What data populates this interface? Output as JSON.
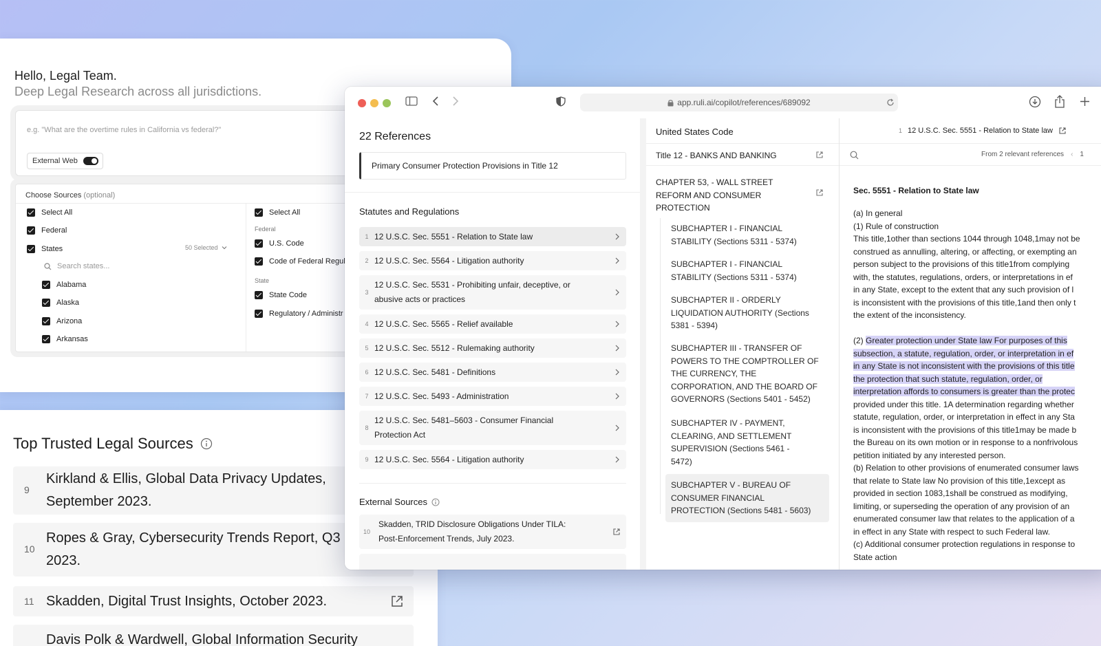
{
  "home": {
    "greeting": "Hello, Legal Team.",
    "subtitle": "Deep Legal Research across all jurisdictions.",
    "query_placeholder": "e.g. \"What are the overtime rules in California vs federal?\"",
    "external_web_label": "External Web",
    "external_web_on": true,
    "sources": {
      "title": "Choose Sources",
      "optional": "(optional)",
      "left": {
        "select_all": "Select All",
        "federal": "Federal",
        "states": "States",
        "states_count": "50 Selected",
        "search_placeholder": "Search states...",
        "state_items": [
          "Alabama",
          "Alaska",
          "Arizona",
          "Arkansas"
        ]
      },
      "right": {
        "select_all": "Select All",
        "federal_label": "Federal",
        "federal_items": [
          "U.S. Code",
          "Code of Federal Regul"
        ],
        "state_label": "State",
        "state_items": [
          "State Code",
          "Regulatory / Administr"
        ]
      }
    }
  },
  "trusted": {
    "title": "Top Trusted Legal Sources",
    "items": [
      {
        "num": "9",
        "lines": [
          "Kirkland & Ellis, Global Data Privacy Updates,",
          "September 2023."
        ]
      },
      {
        "num": "10",
        "lines": [
          "Ropes & Gray, Cybersecurity Trends Report, Q3",
          "2023."
        ]
      },
      {
        "num": "11",
        "lines": [
          "Skadden, Digital Trust Insights, October 2023."
        ]
      },
      {
        "num": "",
        "lines": [
          "Davis Polk & Wardwell, Global Information Security"
        ]
      }
    ]
  },
  "browser": {
    "url": "app.ruli.ai/copilot/references/689092",
    "traffic_colors": [
      "#ee5f57",
      "#f4bd4f",
      "#9bc55b"
    ]
  },
  "references": {
    "count_title": "22 References",
    "primary": "Primary Consumer Protection Provisions in Title 12",
    "statutes_heading": "Statutes and Regulations",
    "statutes": [
      {
        "num": "1",
        "lines": [
          "12 U.S.C. Sec. 5551 - Relation to State law"
        ]
      },
      {
        "num": "2",
        "lines": [
          "12 U.S.C. Sec. 5564 - Litigation authority"
        ]
      },
      {
        "num": "3",
        "lines": [
          "12 U.S.C. Sec. 5531 - Prohibiting unfair, deceptive, or",
          "abusive acts or practices"
        ]
      },
      {
        "num": "4",
        "lines": [
          "12 U.S.C. Sec. 5565 - Relief available"
        ]
      },
      {
        "num": "5",
        "lines": [
          "12 U.S.C. Sec. 5512 - Rulemaking authority"
        ]
      },
      {
        "num": "6",
        "lines": [
          "12 U.S.C. Sec. 5481 - Definitions"
        ]
      },
      {
        "num": "7",
        "lines": [
          "12 U.S.C. Sec. 5493 - Administration"
        ]
      },
      {
        "num": "8",
        "lines": [
          "12 U.S.C. Sec. 5481–5603 - Consumer Financial",
          "Protection Act"
        ]
      },
      {
        "num": "9",
        "lines": [
          "12 U.S.C. Sec. 5564 - Litigation authority"
        ]
      }
    ],
    "external_heading": "External Sources",
    "external": [
      {
        "num": "10",
        "lines": [
          "Skadden, TRID Disclosure Obligations Under TILA:",
          "Post-Enforcement Trends, July 2023."
        ]
      }
    ]
  },
  "usc": {
    "heading": "United States Code",
    "title": "Title 12 - BANKS AND BANKING",
    "chapter_lines": [
      "CHAPTER 53, - WALL STREET",
      "REFORM AND CONSUMER",
      "PROTECTION"
    ],
    "subchapters": [
      {
        "lines": [
          "SUBCHAPTER I - FINANCIAL",
          "STABILITY (Sections 5311 - 5374)"
        ]
      },
      {
        "lines": [
          "SUBCHAPTER I - FINANCIAL",
          "STABILITY (Sections 5311 - 5374)"
        ]
      },
      {
        "lines": [
          "SUBCHAPTER II - ORDERLY",
          "LIQUIDATION AUTHORITY (Sections",
          "5381 - 5394)"
        ]
      },
      {
        "lines": [
          "SUBCHAPTER III - TRANSFER OF",
          "POWERS TO THE COMPTROLLER OF",
          "THE CURRENCY, THE",
          "CORPORATION, AND THE BOARD OF",
          "GOVERNORS (Sections 5401 - 5452)"
        ]
      },
      {
        "lines": [
          "SUBCHAPTER IV - PAYMENT,",
          "CLEARING, AND SETTLEMENT",
          "SUPERVISION (Sections 5461 -",
          "5472)"
        ]
      },
      {
        "lines": [
          "SUBCHAPTER V - BUREAU OF",
          "CONSUMER FINANCIAL",
          "PROTECTION (Sections 5481 - 5603)"
        ]
      }
    ]
  },
  "section": {
    "badge": "1",
    "top_title": "12 U.S.C. Sec. 5551 - Relation to State law",
    "relevant": "From 2 relevant references",
    "pager": "1",
    "title": "Sec. 5551 - Relation to State law",
    "para_a": [
      "(a) In general",
      "(1) Rule of construction",
      "This title,1other than sections 1044 through 1048,1may not be",
      "construed as annulling, altering, or affecting, or exempting an",
      "person subject to the provisions of this title1from complying",
      "with, the statutes, regulations, orders, or interpretations in ef",
      "in any State, except to the extent that any such provision of l",
      "is inconsistent with the provisions of this title,1and then only t",
      "the extent of the inconsistency."
    ],
    "para2_prefix": "(2) ",
    "para2_highlight": [
      "Greater protection under State law For purposes of this",
      "subsection, a statute, regulation, order, or interpretation in ef",
      "in any State is not inconsistent with the provisions of this title",
      "the protection that such statute, regulation, order, or",
      "interpretation affords to consumers is greater than the protec"
    ],
    "para2_rest": [
      "provided under this title. 1A determination regarding whether",
      "statute, regulation, order, or interpretation in effect in any Sta",
      "is inconsistent with the provisions of this title1may be made b",
      "the Bureau on its own motion or in response to a nonfrivolous",
      "petition initiated by any interested person.",
      "(b) Relation to other provisions of enumerated consumer laws",
      "that relate to State law No provision of this title,1except as",
      "provided in section 1083,1shall be construed as modifying,",
      "limiting, or superseding the operation of any provision of an",
      "enumerated consumer law that relates to the application of a",
      "in effect in any State with respect to such Federal law.",
      "(c) Additional consumer protection regulations in response to",
      "State action"
    ]
  }
}
